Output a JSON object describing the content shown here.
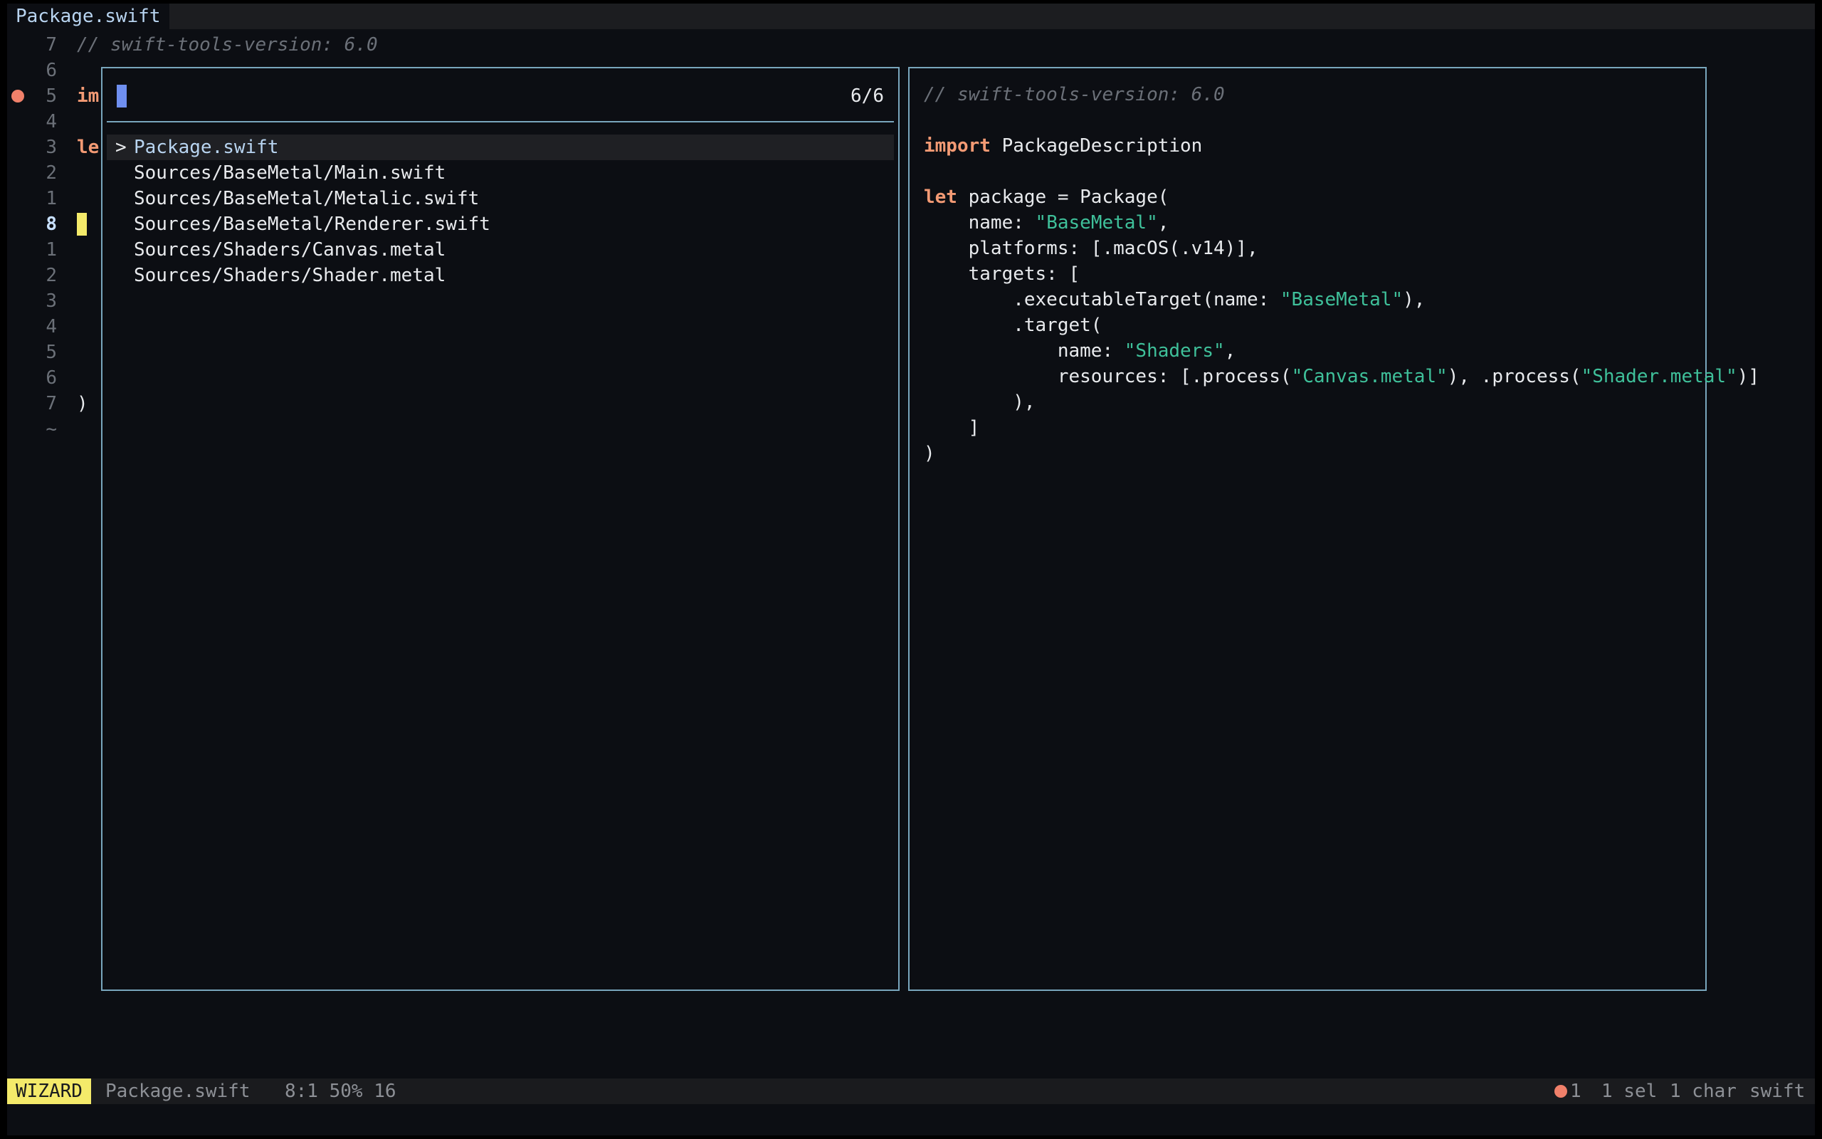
{
  "tabs": [
    "Package.swift"
  ],
  "editor": {
    "line_numbers": [
      "7",
      "6",
      "5",
      "4",
      "3",
      "2",
      "1",
      "8",
      "1",
      "2",
      "3",
      "4",
      "5",
      "6",
      "7",
      "~"
    ],
    "current_line_index": 7,
    "diagnostic_line_index": 2,
    "visible_code": {
      "line0": "// swift-tools-version: 6.0",
      "line2": "im",
      "line4": "le",
      "line14": ")"
    }
  },
  "picker": {
    "query": "",
    "count": "6/6",
    "selected_index": 0,
    "selection_marker": ">",
    "items": [
      "Package.swift",
      "Sources/BaseMetal/Main.swift",
      "Sources/BaseMetal/Metalic.swift",
      "Sources/BaseMetal/Renderer.swift",
      "Sources/Shaders/Canvas.metal",
      "Sources/Shaders/Shader.metal"
    ]
  },
  "preview": {
    "comment": "// swift-tools-version: 6.0",
    "import_kw": "import",
    "import_name": " PackageDescription",
    "let_kw": "let",
    "let_rest": " package = Package(",
    "name_key": "    name: ",
    "name_val": "\"BaseMetal\"",
    "name_end": ",",
    "platforms": "    platforms: [.macOS(.v14)],",
    "targets": "    targets: [",
    "exec_pre": "        .executableTarget(name: ",
    "exec_val": "\"BaseMetal\"",
    "exec_end": "),",
    "target_open": "        .target(",
    "tname_key": "            name: ",
    "tname_val": "\"Shaders\"",
    "tname_end": ",",
    "res_pre": "            resources: [.process(",
    "res_val1": "\"Canvas.metal\"",
    "res_mid": "), .process(",
    "res_val2": "\"Shader.metal\"",
    "res_end": ")]",
    "target_close": "        ),",
    "targets_close": "    ]",
    "close": ")"
  },
  "statusbar": {
    "mode": "WIZARD",
    "filename": "Package.swift",
    "position": "8:1 50% 16",
    "diagnostics": "1",
    "selections": "1 sel",
    "chars": "1 char",
    "language": "swift"
  },
  "colors": {
    "background": "#0c0e13",
    "panel_border": "#79a6bd",
    "keyword": "#f39a74",
    "string": "#3fc09a",
    "mode_badge": "#f4ea6a",
    "error_dot": "#f0806a"
  }
}
